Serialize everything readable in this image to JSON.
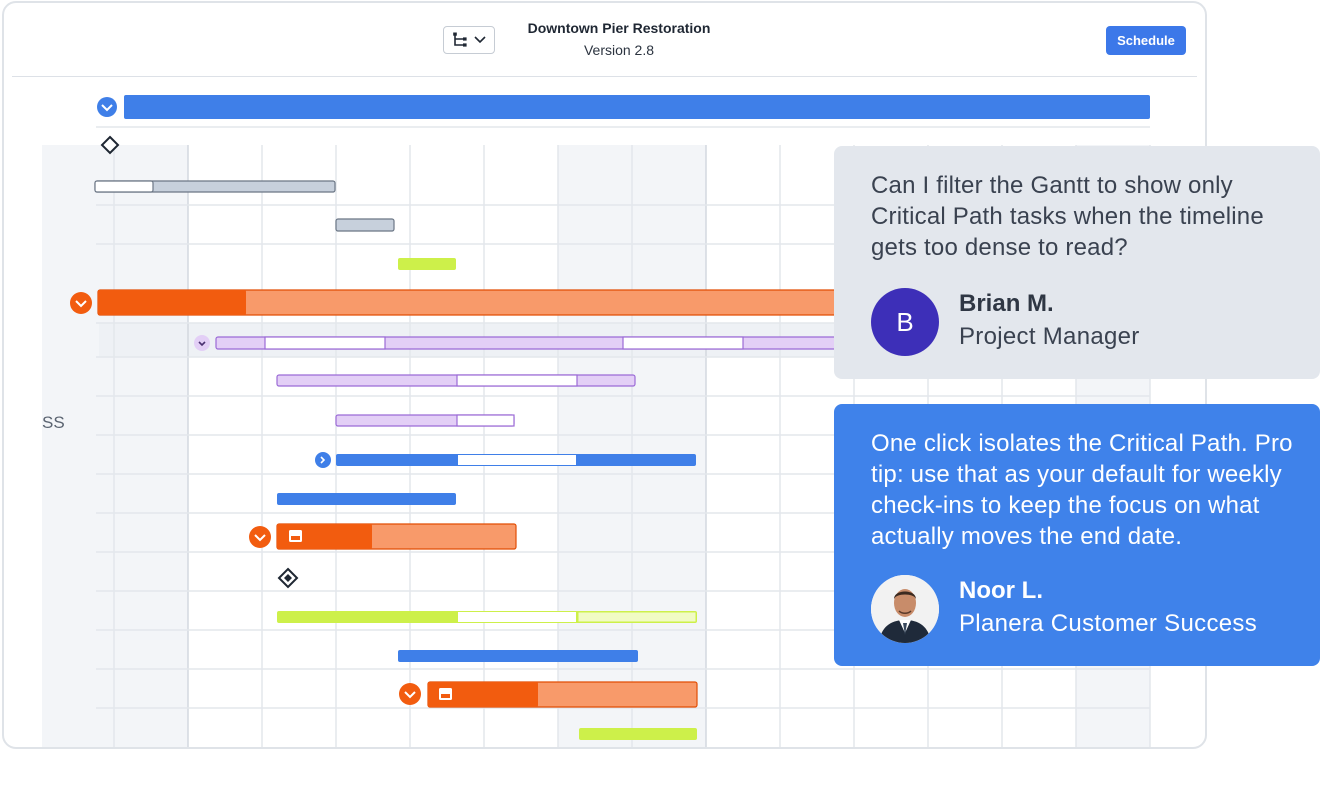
{
  "header": {
    "title": "Downtown Pier Restoration",
    "version": "Version 2.8",
    "schedule_label": "Schedule",
    "view_icon": "hierarchy-icon"
  },
  "gantt": {
    "side_label": "SS",
    "colors": {
      "blue": "#3f7fe8",
      "orange": "#f25c0f",
      "orange_light": "#f89a6a",
      "purple": "#e3cff6",
      "purple_border": "#9b6bd6",
      "gray": "#c7d0dc",
      "lime": "#cdf04a"
    }
  },
  "chat": {
    "question": {
      "text": "Can I filter the Gantt to show only Critical Path tasks when the timeline gets too dense to read?",
      "author_initial": "B",
      "author_name": "Brian M.",
      "author_role": "Project Manager"
    },
    "answer": {
      "text": "One click isolates the Critical Path. Pro tip: use that as your default for weekly check-ins to keep the focus on what actually moves the end date.",
      "author_name": "Noor L.",
      "author_role": "Planera Customer Success"
    }
  }
}
